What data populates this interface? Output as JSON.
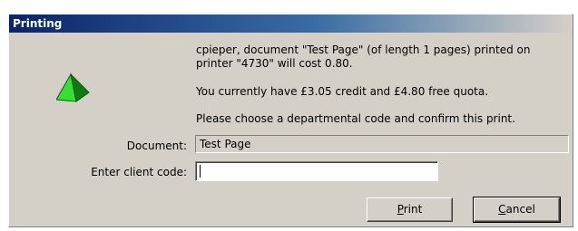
{
  "window": {
    "title": "Printing"
  },
  "message": {
    "line1": "cpieper, document \"Test Page\" (of length 1 pages) printed on printer \"4730\" will cost  0.80.",
    "line2": "You currently have £3.05 credit and £4.80 free quota.",
    "line3": "Please choose a departmental code and confirm this print."
  },
  "form": {
    "document_label": "Document:",
    "document_value": "Test Page",
    "client_code_label": "Enter client code:",
    "client_code_value": ""
  },
  "buttons": {
    "print_first": "P",
    "print_rest": "rint",
    "cancel_first": "C",
    "cancel_rest": "ancel"
  },
  "icon": {
    "name": "green-pyramid-icon",
    "color": "#2bd62b"
  }
}
